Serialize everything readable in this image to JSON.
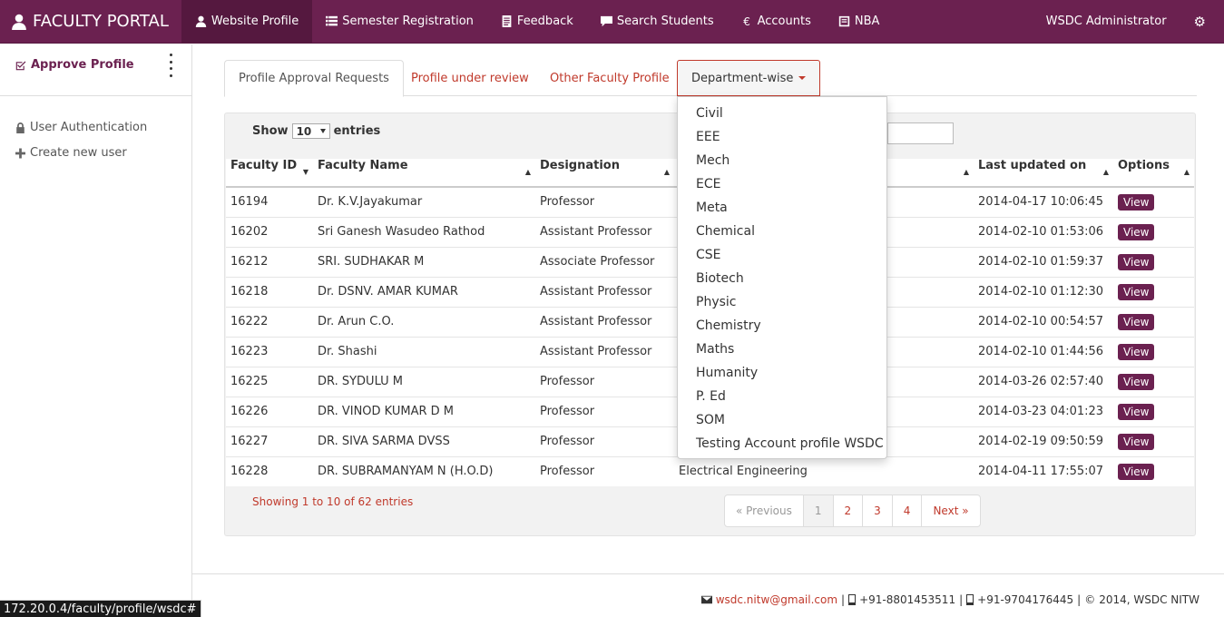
{
  "navbar": {
    "brand": "FACULTY PORTAL",
    "items": [
      {
        "label": "Website Profile",
        "icon": "user-icon"
      },
      {
        "label": "Semester Registration",
        "icon": "list-icon"
      },
      {
        "label": "Feedback",
        "icon": "document-icon"
      },
      {
        "label": "Search Students",
        "icon": "comment-icon"
      },
      {
        "label": "Accounts",
        "icon": "euro-icon"
      },
      {
        "label": "NBA",
        "icon": "book-icon"
      }
    ],
    "user": "WSDC Administrator",
    "settings_icon": "gear-icon"
  },
  "sidebar": {
    "approve": "Approve Profile",
    "links": [
      "User Authentication",
      "Create new user"
    ]
  },
  "tabs": [
    "Profile Approval Requests",
    "Profile under review",
    "Other Faculty Profile",
    "Department-wise"
  ],
  "table_controls": {
    "show": "Show",
    "entries_value": "10",
    "entries": "entries"
  },
  "table": {
    "headers": [
      "Faculty ID",
      "Faculty Name",
      "Designation",
      "",
      "Last updated on",
      "Options"
    ],
    "rows": [
      [
        "16194",
        "Dr. K.V.Jayakumar",
        "Professor",
        "",
        "2014-04-17 10:06:45",
        "View"
      ],
      [
        "16202",
        "Sri Ganesh Wasudeo Rathod",
        "Assistant Professor",
        "",
        "2014-02-10 01:53:06",
        "View"
      ],
      [
        "16212",
        "SRI. SUDHAKAR M",
        "Associate Professor",
        "",
        "2014-02-10 01:59:37",
        "View"
      ],
      [
        "16218",
        "Dr. DSNV. AMAR KUMAR",
        "Assistant Professor",
        "",
        "2014-02-10 01:12:30",
        "View"
      ],
      [
        "16222",
        "Dr. Arun C.O.",
        "Assistant Professor",
        "",
        "2014-02-10 00:54:57",
        "View"
      ],
      [
        "16223",
        "Dr. Shashi",
        "Assistant Professor",
        "",
        "2014-02-10 01:44:56",
        "View"
      ],
      [
        "16225",
        "DR. SYDULU M",
        "Professor",
        "",
        "2014-03-26 02:57:40",
        "View"
      ],
      [
        "16226",
        "DR. VINOD KUMAR D M",
        "Professor",
        "",
        "2014-03-23 04:01:23",
        "View"
      ],
      [
        "16227",
        "DR. SIVA SARMA DVSS",
        "Professor",
        "",
        "2014-02-19 09:50:59",
        "View"
      ],
      [
        "16228",
        "DR.  SUBRAMANYAM N (H.O.D)",
        "Professor",
        "Electrical Engineering",
        "2014-04-11 17:55:07",
        "View"
      ]
    ]
  },
  "info": "Showing 1 to 10 of 62 entries",
  "pagination": [
    "« Previous",
    "1",
    "2",
    "3",
    "4",
    "Next »"
  ],
  "dropdown": [
    "Civil",
    "EEE",
    "Mech",
    "ECE",
    "Meta",
    "Chemical",
    "CSE",
    "Biotech",
    "Physic",
    "Chemistry",
    "Maths",
    "Humanity",
    "P. Ed",
    "SOM",
    "Testing Account profile WSDC"
  ],
  "footer": {
    "email": "wsdc.nitw@gmail.com",
    "phone1": "+91-8801453511",
    "phone2": "+91-9704176445",
    "copyright": "2014, WSDC NITW"
  },
  "status_url": "172.20.0.4/faculty/profile/wsdc#",
  "colors": {
    "brand": "#6b2150",
    "link": "#c0392b"
  }
}
